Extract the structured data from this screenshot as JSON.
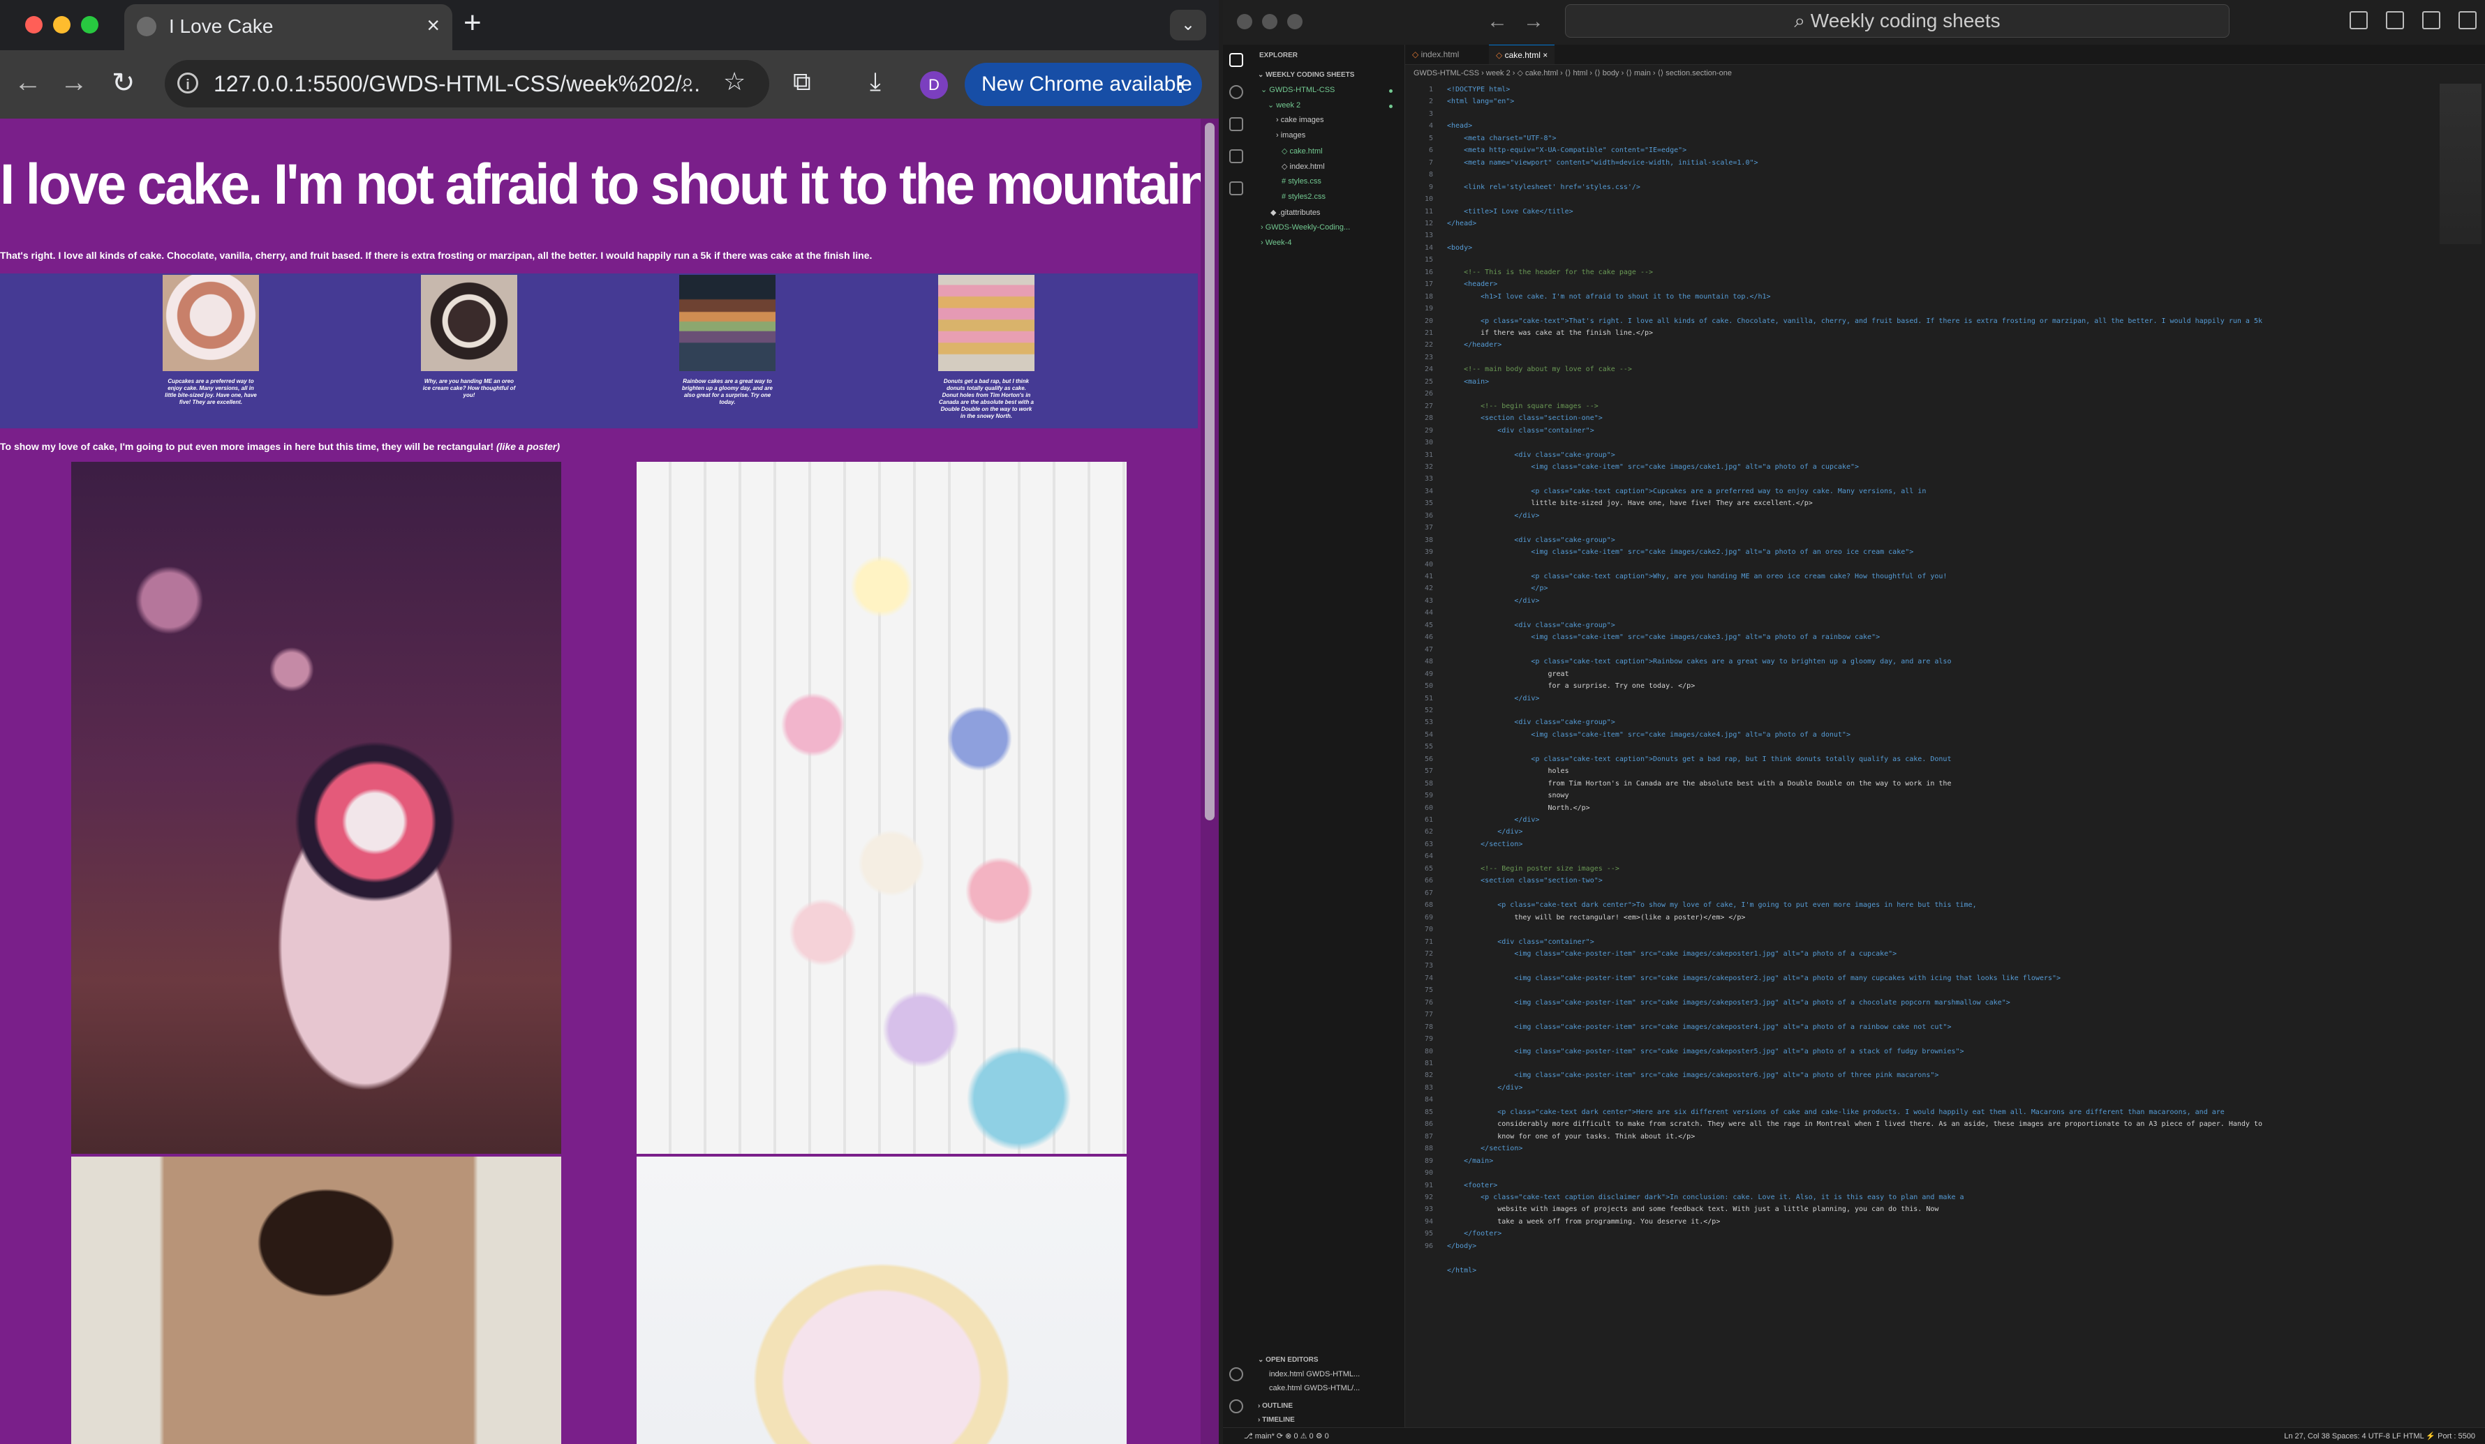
{
  "browser": {
    "tab_title": "I Love Cake",
    "tab_close": "×",
    "new_tab": "+",
    "tab_menu": "⌄",
    "url": "127.0.0.1:5500/GWDS-HTML-CSS/week%202/...",
    "update_button": "New Chrome available",
    "update_menu": "⋮",
    "avatar_letter": "D",
    "icons": {
      "back": "←",
      "forward": "→",
      "reload": "↻",
      "zoom": "⌕",
      "star": "☆",
      "extensions": "⧉",
      "download": "⤓"
    }
  },
  "page": {
    "heading": "I love cake. I'm not afraid to shout it to the mountain top.",
    "lead": "That's right. I love all kinds of cake. Chocolate, vanilla, cherry, and fruit based. If there is extra frosting or marzipan, all the better. I would happily run a 5k if there was cake at the finish line.",
    "cakes": [
      {
        "caption": "Cupcakes are a preferred way to enjoy cake. Many versions, all in little bite-sized joy. Have one, have five! They are excellent."
      },
      {
        "caption": "Why, are you handing ME an oreo ice cream cake? How thoughtful of you!"
      },
      {
        "caption": "Rainbow cakes are a great way to brighten up a gloomy day, and are also great for a surprise. Try one today."
      },
      {
        "caption": "Donuts get a bad rap, but I think donuts totally qualify as cake. Donut holes from Tim Horton's in Canada are the absolute best with a Double Double on the way to work in the snowy North."
      }
    ],
    "intro": "To show my love of cake, I'm going to put even more images in here but this time, they will be rectangular!",
    "intro_em": "(like a poster)"
  },
  "vscode": {
    "search": "Weekly coding sheets",
    "explorer_title": "EXPLORER",
    "workspace": "WEEKLY CODING SHEETS",
    "tree": [
      {
        "label": "GWDS-HTML-CSS"
      },
      {
        "label": "week 2"
      },
      {
        "label": "cake images"
      },
      {
        "label": "images"
      },
      {
        "label": "cake.html"
      },
      {
        "label": "index.html"
      },
      {
        "label": "styles.css"
      },
      {
        "label": "styles2.css"
      },
      {
        "label": ".gitattributes"
      },
      {
        "label": "GWDS-Weekly-Coding..."
      },
      {
        "label": "Week-4"
      }
    ],
    "open_editors_title": "OPEN EDITORS",
    "open_editors": [
      "index.html  GWDS-HTML...",
      "cake.html  GWDS-HTML/..."
    ],
    "outline": "OUTLINE",
    "timeline": "TIMELINE",
    "tabs": [
      "index.html",
      "cake.html"
    ],
    "breadcrumb": "GWDS-HTML-CSS › week 2 › ◇ cake.html › ⟨⟩ html › ⟨⟩ body › ⟨⟩ main › ⟨⟩ section.section-one",
    "code_lines": [
      "<!DOCTYPE html>",
      "<html lang=\"en\">",
      "",
      "<head>",
      "    <meta charset=\"UTF-8\">",
      "    <meta http-equiv=\"X-UA-Compatible\" content=\"IE=edge\">",
      "    <meta name=\"viewport\" content=\"width=device-width, initial-scale=1.0\">",
      "",
      "    <link rel='stylesheet' href='styles.css'/>",
      "",
      "    <title>I Love Cake</title>",
      "</head>",
      "",
      "<body>",
      "",
      "    <!-- This is the header for the cake page -->",
      "    <header>",
      "        <h1>I love cake. I'm not afraid to shout it to the mountain top.</h1>",
      "",
      "        <p class=\"cake-text\">That's right. I love all kinds of cake. Chocolate, vanilla, cherry, and fruit based. If there is extra frosting or marzipan, all the better. I would happily run a 5k",
      "        if there was cake at the finish line.</p>",
      "    </header>",
      "",
      "    <!-- main body about my love of cake -->",
      "    <main>",
      "",
      "        <!-- begin square images -->",
      "        <section class=\"section-one\">",
      "            <div class=\"container\">",
      "",
      "                <div class=\"cake-group\">",
      "                    <img class=\"cake-item\" src=\"cake images/cake1.jpg\" alt=\"a photo of a cupcake\">",
      "",
      "                    <p class=\"cake-text caption\">Cupcakes are a preferred way to enjoy cake. Many versions, all in",
      "                    little bite-sized joy. Have one, have five! They are excellent.</p>",
      "                </div>",
      "",
      "                <div class=\"cake-group\">",
      "                    <img class=\"cake-item\" src=\"cake images/cake2.jpg\" alt=\"a photo of an oreo ice cream cake\">",
      "",
      "                    <p class=\"cake-text caption\">Why, are you handing ME an oreo ice cream cake? How thoughtful of you!",
      "                    </p>",
      "                </div>",
      "",
      "                <div class=\"cake-group\">",
      "                    <img class=\"cake-item\" src=\"cake images/cake3.jpg\" alt=\"a photo of a rainbow cake\">",
      "",
      "                    <p class=\"cake-text caption\">Rainbow cakes are a great way to brighten up a gloomy day, and are also",
      "                        great",
      "                        for a surprise. Try one today. </p>",
      "                </div>",
      "",
      "                <div class=\"cake-group\">",
      "                    <img class=\"cake-item\" src=\"cake images/cake4.jpg\" alt=\"a photo of a donut\">",
      "",
      "                    <p class=\"cake-text caption\">Donuts get a bad rap, but I think donuts totally qualify as cake. Donut",
      "                        holes",
      "                        from Tim Horton's in Canada are the absolute best with a Double Double on the way to work in the",
      "                        snowy",
      "                        North.</p>",
      "                </div>",
      "            </div>",
      "        </section>",
      "",
      "        <!-- Begin poster size images -->",
      "        <section class=\"section-two\">",
      "",
      "            <p class=\"cake-text dark center\">To show my love of cake, I'm going to put even more images in here but this time,",
      "                they will be rectangular! <em>(like a poster)</em> </p>",
      "",
      "            <div class=\"container\">",
      "                <img class=\"cake-poster-item\" src=\"cake images/cakeposter1.jpg\" alt=\"a photo of a cupcake\">",
      "",
      "                <img class=\"cake-poster-item\" src=\"cake images/cakeposter2.jpg\" alt=\"a photo of many cupcakes with icing that looks like flowers\">",
      "",
      "                <img class=\"cake-poster-item\" src=\"cake images/cakeposter3.jpg\" alt=\"a photo of a chocolate popcorn marshmallow cake\">",
      "",
      "                <img class=\"cake-poster-item\" src=\"cake images/cakeposter4.jpg\" alt=\"a photo of a rainbow cake not cut\">",
      "",
      "                <img class=\"cake-poster-item\" src=\"cake images/cakeposter5.jpg\" alt=\"a photo of a stack of fudgy brownies\">",
      "",
      "                <img class=\"cake-poster-item\" src=\"cake images/cakeposter6.jpg\" alt=\"a photo of three pink macarons\">",
      "            </div>",
      "",
      "            <p class=\"cake-text dark center\">Here are six different versions of cake and cake-like products. I would happily eat them all. Macarons are different than macaroons, and are",
      "            considerably more difficult to make from scratch. They were all the rage in Montreal when I lived there. As an aside, these images are proportionate to an A3 piece of paper. Handy to",
      "            know for one of your tasks. Think about it.</p>",
      "        </section>",
      "    </main>",
      "",
      "    <footer>",
      "        <p class=\"cake-text caption disclaimer dark\">In conclusion: cake. Love it. Also, it is this easy to plan and make a",
      "            website with images of projects and some feedback text. With just a little planning, you can do this. Now",
      "            take a week off from programming. You deserve it.</p>",
      "    </footer>",
      "</body>",
      "",
      "</html>",
      ""
    ],
    "line_numbers": [
      "1",
      "2",
      "3",
      "4",
      "5",
      "6",
      "7",
      "8",
      "9",
      "10",
      "11",
      "12",
      "13",
      "14",
      "15",
      "16",
      "17",
      "18",
      "19",
      "20",
      "21",
      "22",
      "23",
      "24",
      "25",
      "26",
      "27",
      "28",
      "29",
      "30",
      "31",
      "32",
      "33",
      "34",
      "35",
      "36",
      "37",
      "38",
      "39",
      "40",
      "41",
      "42",
      "43",
      "44",
      "45",
      "46",
      "47",
      "48",
      "49",
      "50",
      "51",
      "52",
      "53",
      "54",
      "55",
      "56",
      "57",
      "58",
      "59",
      "60",
      "61",
      "62",
      "63",
      "64",
      "65",
      "66",
      "67",
      "68",
      "69",
      "70",
      "71",
      "72",
      "73",
      "74",
      "75",
      "76",
      "77",
      "78",
      "79",
      "80",
      "81",
      "82",
      "83",
      "84",
      "85",
      "86",
      "87",
      "88",
      "89",
      "90",
      "91",
      "92",
      "93",
      "94",
      "95",
      "96"
    ],
    "status_left": "⎇ main*   ⟳   ⊗ 0 ⚠ 0   ⚙ 0",
    "status_right": "Ln 27, Col 38    Spaces: 4    UTF-8    LF    HTML    ⚡ Port : 5500"
  }
}
